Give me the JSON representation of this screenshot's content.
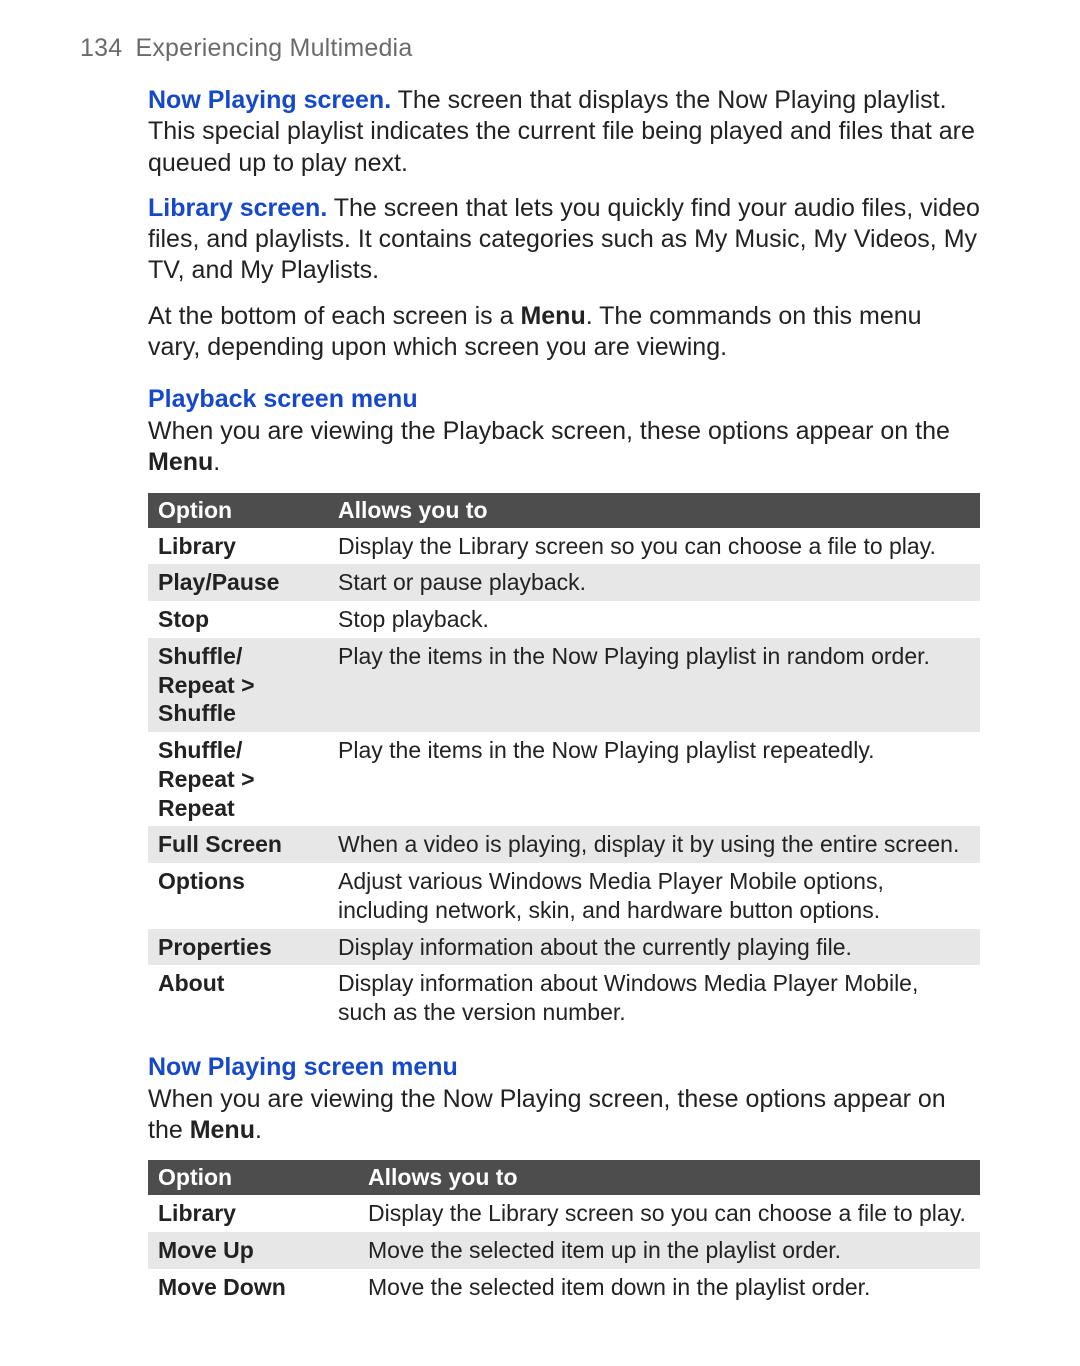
{
  "header": {
    "page_number": "134",
    "chapter_title": "Experiencing Multimedia"
  },
  "para1": {
    "lead": "Now Playing screen.",
    "text": " The screen that displays the Now Playing playlist. This special playlist indicates the current file being played and files that are queued up to play next."
  },
  "para2": {
    "lead": "Library screen.",
    "text": " The screen that lets you quickly find your audio files, video files, and playlists. It contains categories such as My Music, My Videos, My TV, and My Playlists."
  },
  "para3": {
    "pre": "At the bottom of each screen is a ",
    "bold": "Menu",
    "post": ". The commands on this menu vary, depending upon which screen you are viewing."
  },
  "section1": {
    "title": "Playback screen menu",
    "intro_pre": "When you are viewing the Playback screen, these options appear on the ",
    "intro_bold": "Menu",
    "intro_post": "."
  },
  "table1": {
    "head_option": "Option",
    "head_allows": "Allows you to",
    "rows": [
      {
        "option": "Library",
        "desc": "Display the Library screen so you can choose a file to play."
      },
      {
        "option": "Play/Pause",
        "desc": "Start or pause playback."
      },
      {
        "option": "Stop",
        "desc": "Stop playback."
      },
      {
        "option": "Shuffle/\nRepeat >\nShuffle",
        "desc": "Play the items in the Now Playing playlist in random order."
      },
      {
        "option": "Shuffle/\nRepeat >\nRepeat",
        "desc": "Play the items in the Now Playing playlist repeatedly."
      },
      {
        "option": "Full Screen",
        "desc": "When a video is playing, display it by using the entire screen."
      },
      {
        "option": "Options",
        "desc": "Adjust various Windows Media Player Mobile options, including network, skin, and hardware button options."
      },
      {
        "option": "Properties",
        "desc": "Display information about the currently playing file."
      },
      {
        "option": "About",
        "desc": "Display information about Windows Media Player Mobile, such as the version number."
      }
    ]
  },
  "section2": {
    "title": "Now Playing screen menu",
    "intro_pre": "When you are viewing the Now Playing screen, these options appear on the ",
    "intro_bold": "Menu",
    "intro_post": "."
  },
  "table2": {
    "head_option": "Option",
    "head_allows": "Allows you to",
    "rows": [
      {
        "option": "Library",
        "desc": "Display the Library screen so you can choose a file to play."
      },
      {
        "option": "Move Up",
        "desc": "Move the selected item up in the playlist order."
      },
      {
        "option": "Move Down",
        "desc": "Move the selected item down in the playlist order."
      }
    ]
  }
}
